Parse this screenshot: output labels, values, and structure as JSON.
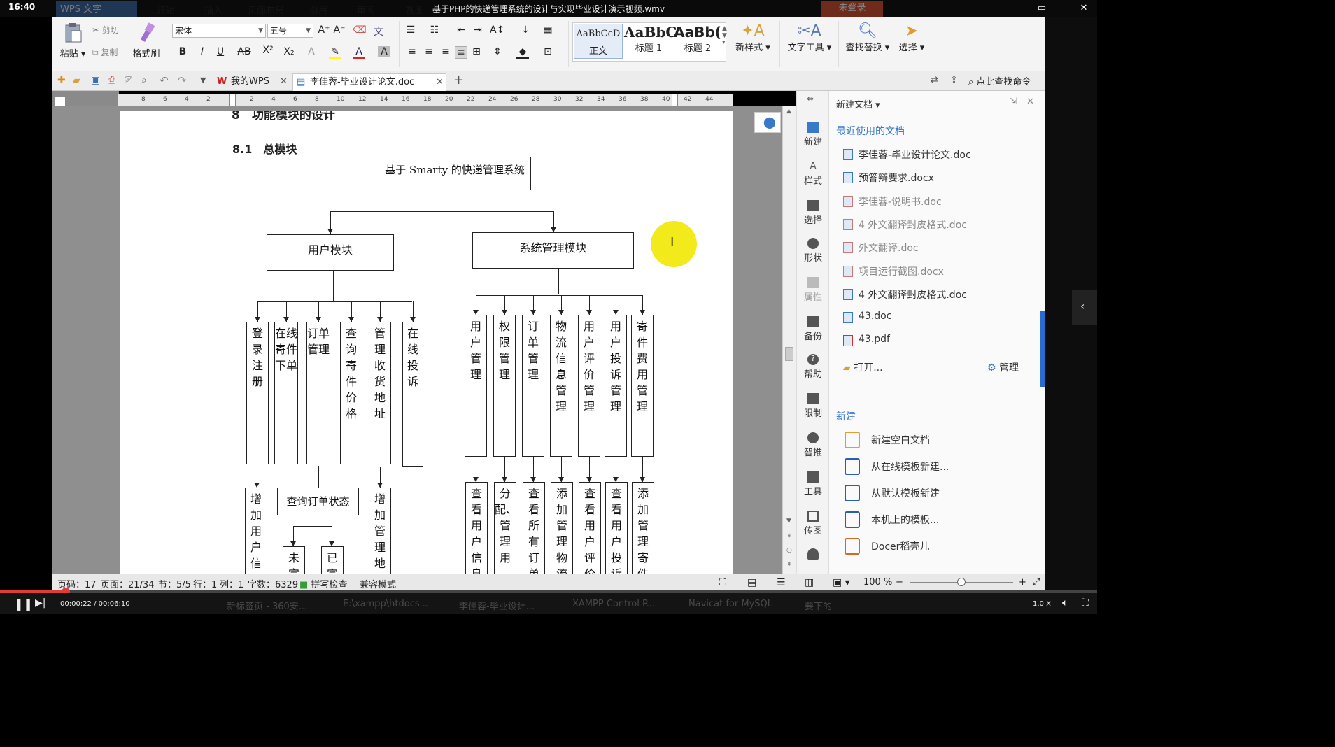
{
  "window": {
    "clock": "16:40",
    "title": "基于PHP的快递管理系统的设计与实现毕业设计演示视频.wmv"
  },
  "menu": [
    "WPS 文字",
    "开始",
    "插入",
    "页面布局",
    "引用",
    "审阅",
    "视图",
    "未登录"
  ],
  "ribbon": {
    "paste": "粘贴",
    "cut": "剪切",
    "copy": "复制",
    "format_painter": "格式刷",
    "font": "宋体",
    "size": "五号",
    "styles": [
      {
        "preview": "AaBbCcD",
        "name": "正文"
      },
      {
        "preview": "AaBbC",
        "name": "标题 1"
      },
      {
        "preview": "AaBb(",
        "name": "标题 2"
      }
    ],
    "new_style": "新样式",
    "text_tools": "文字工具",
    "find_replace": "查找替换",
    "select": "选择"
  },
  "tabs": {
    "mywps": "我的WPS",
    "doc": "李佳蓉-毕业设计论文.doc",
    "add": "+",
    "search": "点此查找命令"
  },
  "ruler": [
    "8",
    "6",
    "4",
    "2",
    "",
    "2",
    "4",
    "6",
    "8",
    "10",
    "12",
    "14",
    "16",
    "18",
    "20",
    "22",
    "24",
    "26",
    "28",
    "30",
    "32",
    "34",
    "36",
    "38",
    "40",
    "42",
    "44"
  ],
  "document": {
    "chapter": "8　功能模块的设计",
    "section": "8.1　总模块",
    "root": "基于 Smarty 的快递管理系统",
    "user_module": "用户模块",
    "sys_module": "系统管理模块",
    "user_children": [
      "登录注册",
      "在线寄件下单",
      "订单管理",
      "查询寄件价格",
      "管理收货地址",
      "在线投诉"
    ],
    "sys_children": [
      "用户管理",
      "权限管理",
      "订单管理",
      "物流信息管理",
      "用户评价管理",
      "用户投诉管理",
      "寄件费用管理"
    ],
    "user_sub": [
      "增加用户信",
      "查询订单状态",
      "增加管理地"
    ],
    "order_sub": [
      "未完",
      "已完"
    ],
    "sys_sub": [
      "查看用户信息",
      "分配、管理用",
      "查看所有订单",
      "添加管理物流",
      "查看用户评价",
      "查看用户投诉",
      "添加管理寄件"
    ]
  },
  "sidebar": [
    "新建",
    "样式",
    "选择",
    "形状",
    "属性",
    "备份",
    "帮助",
    "限制",
    "智推",
    "工具",
    "传图"
  ],
  "panel": {
    "header": "新建文档",
    "recent_title": "最近使用的文档",
    "recent": [
      "李佳蓉-毕业设计论文.doc",
      "预答辩要求.docx",
      "李佳蓉-说明书.doc",
      "4 外文翻译封皮格式.doc",
      "外文翻译.doc",
      "项目运行截图.docx",
      "4 外文翻译封皮格式.doc",
      "43.doc",
      "43.pdf"
    ],
    "open": "打开...",
    "manage": "管理",
    "new_title": "新建",
    "new_items": [
      "新建空白文档",
      "从在线模板新建...",
      "从默认模板新建",
      "本机上的模板...",
      "Docer稻壳儿"
    ]
  },
  "status": {
    "page": "页码：17",
    "pages": "页面：21/34",
    "section": "节：5/5",
    "row": "行：1",
    "col": "列：1",
    "words": "字数：6329",
    "spell": "拼写检查",
    "compat": "兼容模式",
    "zoom": "100 %"
  },
  "player": {
    "time": "00:00:22 / 00:06:10",
    "speed": "1.0 X",
    "progress": 0.06
  },
  "taskbar": [
    "新标签页 - 360安...",
    "E:\\xampp\\htdocs...",
    "李佳蓉-毕业设计...",
    "XAMPP Control P...",
    "Navicat for MySQL",
    "要下的"
  ]
}
